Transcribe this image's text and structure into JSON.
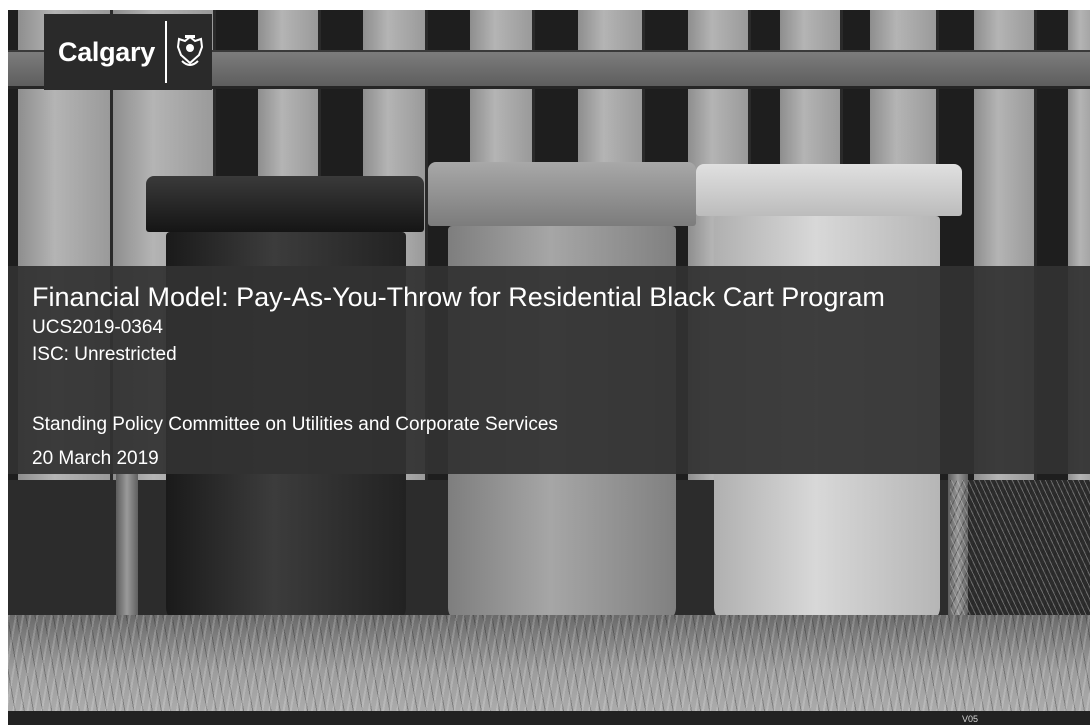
{
  "logo": {
    "wordmark": "Calgary",
    "crest_icon": "city-crest-icon"
  },
  "slide": {
    "title": "Financial Model: Pay-As-You-Throw for Residential Black Cart Program",
    "report_number": "UCS2019-0364",
    "classification": "ISC: Unrestricted",
    "committee": "Standing Policy Committee on Utilities and Corporate Services",
    "date": "20 March 2019"
  },
  "footer": {
    "version": "V05"
  },
  "colors": {
    "band": "#323232",
    "text": "#ffffff"
  }
}
